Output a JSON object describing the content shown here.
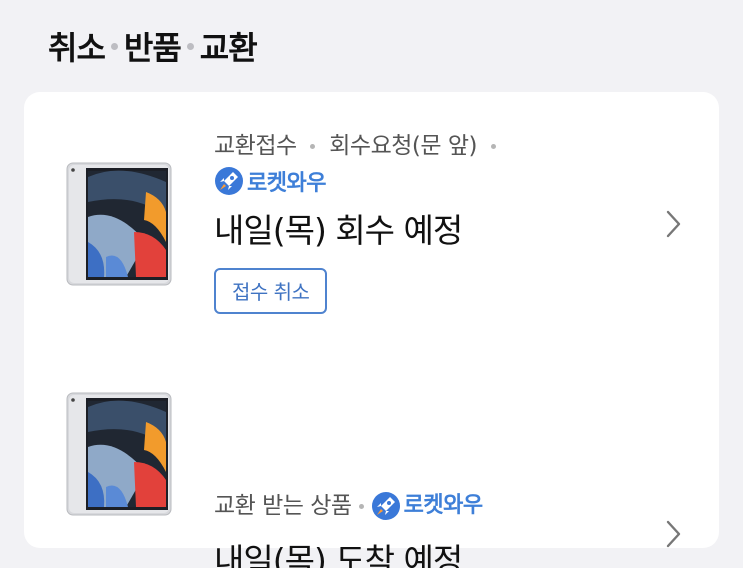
{
  "header": {
    "title_parts": [
      "취소",
      "반품",
      "교환"
    ]
  },
  "items": [
    {
      "meta_parts": [
        "교환접수",
        "회수요청(문 앞)"
      ],
      "badge_label": "로켓와우",
      "badge_icon": "rocket-icon",
      "status": "내일(목) 회수 예정",
      "action_label": "접수 취소",
      "thumbnail": "tablet-image",
      "chevron": "chevron-right-icon"
    },
    {
      "meta_parts": [
        "교환 받는 상품"
      ],
      "badge_label": "로켓와우",
      "badge_icon": "rocket-icon",
      "status": "내일(목) 도착 예정",
      "thumbnail": "tablet-image",
      "chevron": "chevron-right-icon"
    }
  ],
  "colors": {
    "accent": "#3e7fd8",
    "background": "#f2f2f5",
    "card": "#ffffff"
  }
}
